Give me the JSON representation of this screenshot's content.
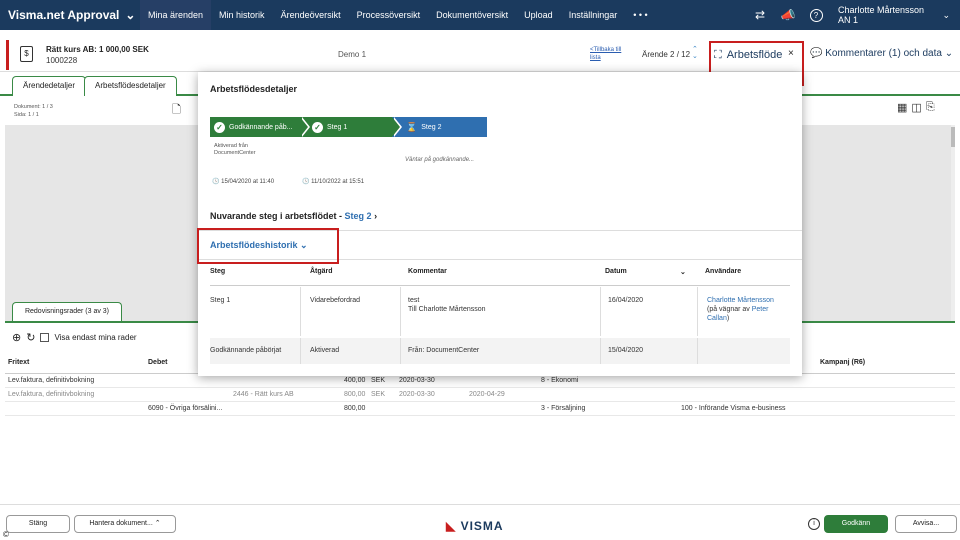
{
  "nav": {
    "brand": "Visma.net Approval",
    "links": [
      "Mina ärenden",
      "Min historik",
      "Ärendeöversikt",
      "Processöversikt",
      "Dokumentöversikt",
      "Upload",
      "Inställningar",
      "• • •"
    ],
    "user_name": "Charlotte Mårtensson",
    "user_sub": "AN 1"
  },
  "case": {
    "title": "Rätt kurs AB: 1 000,00 SEK",
    "number": "1000228",
    "demo": "Demo 1",
    "back_link": "<Tillbaka till lista",
    "counter": "Ärende 2 / 12",
    "workflow_label": "Arbetsflöde",
    "comments_label": "Kommentarer (1) och data"
  },
  "tabs": {
    "details": "Ärendedetaljer",
    "workflow": "Arbetsflödesdetaljer"
  },
  "document": {
    "doc_line": "Dokument: 1 / 3",
    "page_line": "Sida: 1 / 1"
  },
  "lines": {
    "tab": "Redovisningsrader (3 av 3)",
    "only_mine": "Visa endast mina rader",
    "headers": {
      "fritext": "Fritext",
      "debet": "Debet",
      "kampanj": "Kampanj (R6)"
    },
    "rows": [
      {
        "fritext": "Lev.faktura, definitivbokning",
        "debet": "",
        "leverantor": "",
        "amount": "400,00",
        "currency": "SEK",
        "date1": "2020-03-30",
        "date2": "",
        "kategori": "8 - Ekonomi",
        "projekt": ""
      },
      {
        "fritext": "Lev.faktura, definitivbokning",
        "debet": "",
        "leverantor": "2446 - Rätt kurs AB",
        "amount": "800,00",
        "currency": "SEK",
        "date1": "2020-03-30",
        "date2": "2020-04-29",
        "kategori": "",
        "projekt": ""
      },
      {
        "fritext": "",
        "debet": "6090 - Övriga försälini...",
        "leverantor": "",
        "amount": "800,00",
        "currency": "",
        "date1": "",
        "date2": "",
        "kategori": "3 - Försäljning",
        "projekt": "100 - Införande Visma e-business"
      }
    ]
  },
  "footer": {
    "close": "Stäng",
    "manage_docs": "Hantera dokument...",
    "logo": "VISMA",
    "approve": "Godkänn",
    "reject": "Avvisa..."
  },
  "panel": {
    "title": "Arbetsflödesdetaljer",
    "steps": [
      {
        "label": "Godkännande påb...",
        "state": "done"
      },
      {
        "label": "Steg 1",
        "state": "done"
      },
      {
        "label": "Steg 2",
        "state": "current"
      }
    ],
    "step0_info": "Aktiverad från DocumentCenter",
    "step0_date": "15/04/2020 at 11:40",
    "step1_date": "11/10/2022 at 15:51",
    "waiting": "Väntar på godkännande...",
    "current_label": "Nuvarande steg i arbetsflödet - ",
    "current_step": "Steg 2",
    "history_label": "Arbetsflödeshistorik",
    "history_headers": {
      "steg": "Steg",
      "atgard": "Åtgärd",
      "kommentar": "Kommentar",
      "datum": "Datum",
      "anvandare": "Användare"
    },
    "history": [
      {
        "steg": "Steg 1",
        "atgard": "Vidarebefordrad",
        "kommentar1": "test",
        "kommentar2": "Till Charlotte Mårtensson",
        "datum": "16/04/2020",
        "user": "Charlotte Mårtensson",
        "on_behalf": "(på vägnar av ",
        "on_behalf_name": "Peter Callan",
        "on_behalf_end": ")"
      },
      {
        "steg": "Godkännande påbörjat",
        "atgard": "Aktiverad",
        "kommentar1": "Från: DocumentCenter",
        "kommentar2": "",
        "datum": "15/04/2020",
        "user": ""
      }
    ]
  },
  "colors": {
    "nav": "#1b3a5e",
    "green": "#2e7d3a",
    "blue": "#2f6fb0",
    "highlight": "#c81e1e"
  }
}
